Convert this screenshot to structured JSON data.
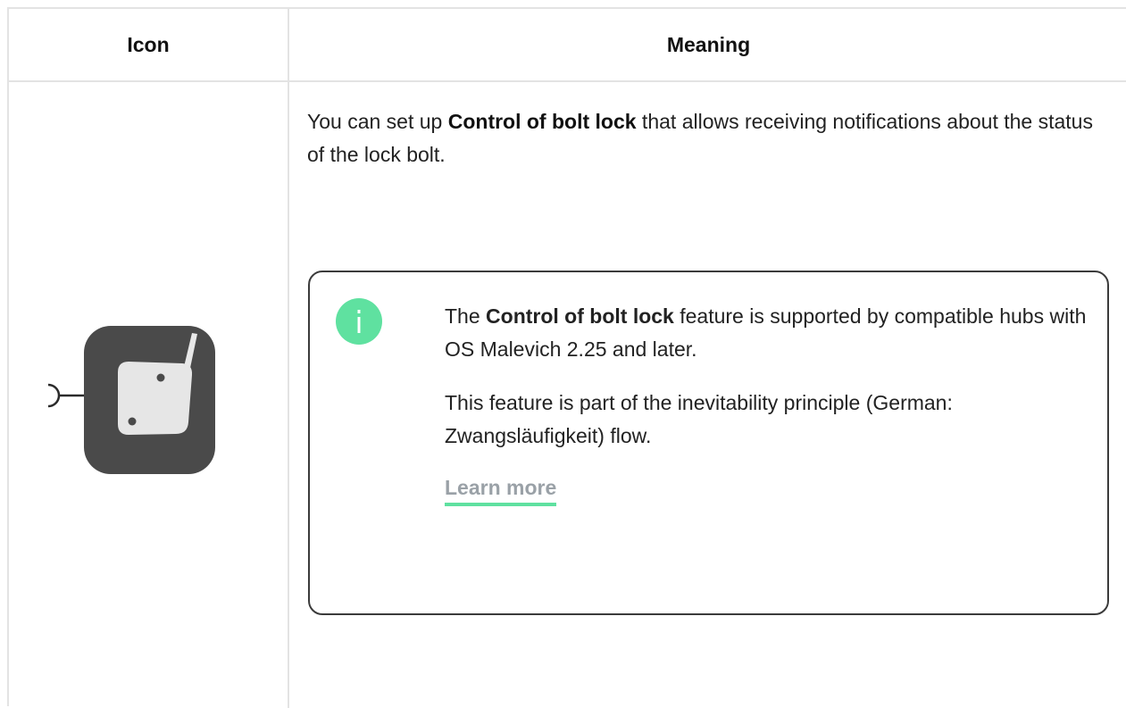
{
  "table": {
    "headers": {
      "icon": "Icon",
      "meaning": "Meaning"
    },
    "row": {
      "icon_name": "bolt-lock-control-icon",
      "meaning": {
        "text_before": "You can set up ",
        "bold": "Control of bolt lock",
        "text_after": " that allows receiving notifications about the status of the lock bolt."
      },
      "note": {
        "icon_name": "info-icon",
        "accent_color": "#5fe1a0",
        "p1_before": "The ",
        "p1_bold": "Control of bolt lock",
        "p1_after": " feature is supported by compatible hubs with OS Malevich 2.25 and later.",
        "p2": "This feature is part of the inevitability principle (German: Zwangsläufigkeit) flow.",
        "link_label": "Learn more"
      }
    }
  }
}
